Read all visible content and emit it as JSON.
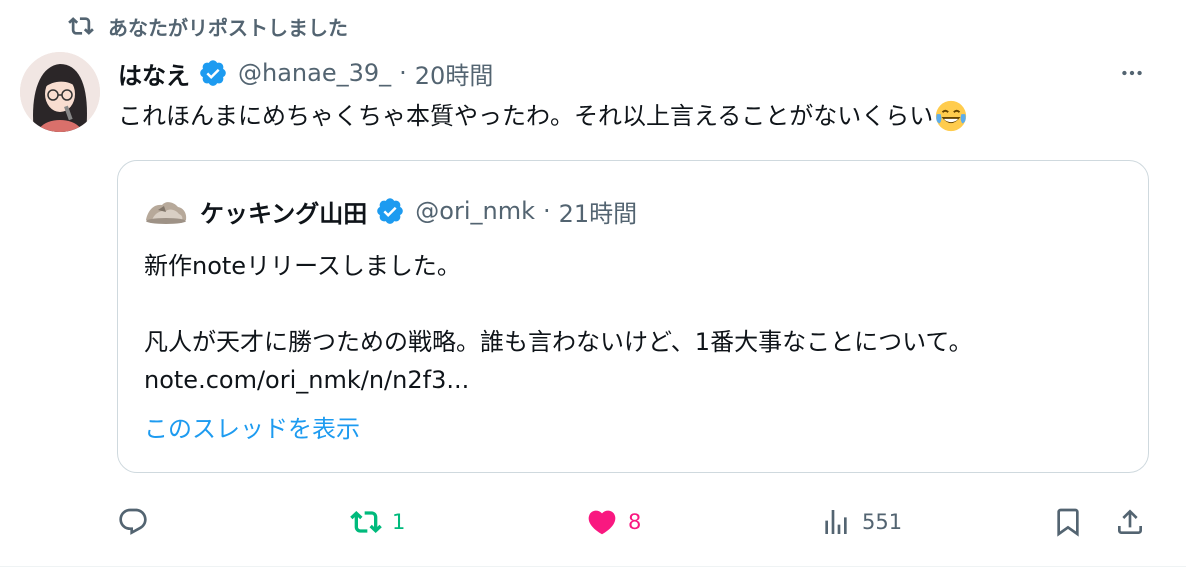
{
  "social_context": {
    "text": "あなたがリポストしました",
    "icon": "repost-icon"
  },
  "tweet": {
    "author_name": "はなえ",
    "handle": "@hanae_39_",
    "separator": "·",
    "time": "20時間",
    "text": "これほんまにめちゃくちゃ本質やったわ。それ以上言えることがないくらい",
    "emoji": "face-with-tears-of-joy",
    "verified": true
  },
  "quoted": {
    "author_name": "ケッキング山田",
    "handle": "@ori_nmk",
    "separator": "·",
    "time": "21時間",
    "line1": "新作noteリリースしました。",
    "line2": "凡人が天才に勝つための戦略。誰も言わないけど、1番大事なことについて。",
    "link": "note.com/ori_nmk/n/n2f3...",
    "thread_link": "このスレッドを表示",
    "verified": true
  },
  "actions": {
    "reply": {
      "icon": "reply-icon",
      "count": ""
    },
    "repost": {
      "icon": "repost-icon",
      "count": "1",
      "active": true
    },
    "like": {
      "icon": "heart-icon",
      "count": "8",
      "active": true
    },
    "views": {
      "icon": "views-icon",
      "count": "551"
    },
    "bookmark": {
      "icon": "bookmark-icon"
    },
    "share": {
      "icon": "share-icon"
    }
  },
  "colors": {
    "text_primary": "#0f1419",
    "text_secondary": "#536471",
    "link": "#1d9bf0",
    "repost_active": "#00ba7c",
    "like_active": "#f91880",
    "verified": "#1d9bf0",
    "border": "#cfd9de"
  }
}
